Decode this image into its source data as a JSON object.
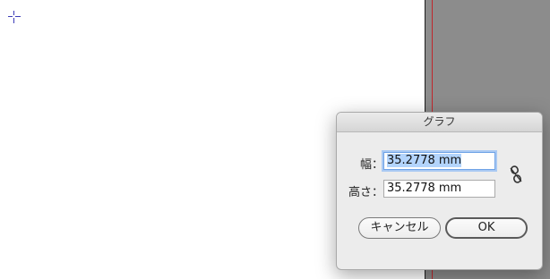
{
  "dialog": {
    "title": "グラフ",
    "width_label": "幅：",
    "width_value": "35.2778 mm",
    "height_label": "高さ：",
    "height_value": "35.2778 mm",
    "cancel_label": "キャンセル",
    "ok_label": "OK"
  },
  "icons": {
    "constrain": "unlinked-chain-icon",
    "cursor": "crosshair-cursor-icon"
  },
  "colors": {
    "pasteboard": "#8c8c8c",
    "guide": "#c0282d",
    "selection": "#b3d4fc",
    "focus_ring": "#a9c9f3"
  }
}
